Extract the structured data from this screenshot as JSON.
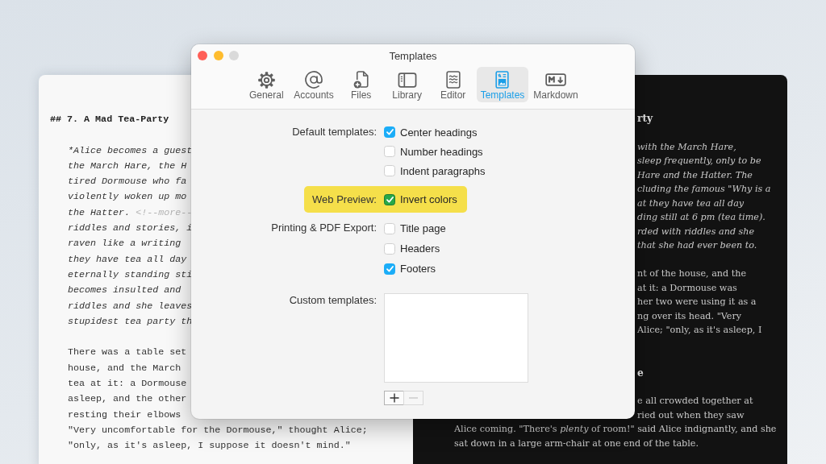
{
  "editor_document": {
    "heading": "## 7. A Mad Tea-Party",
    "paragraphs": [
      {
        "italic": true,
        "lines": [
          {
            "text": "*Alice becomes a guest"
          },
          {
            "text": "the March Hare, the H"
          },
          {
            "text": "tired Dormouse who fa"
          },
          {
            "text": "violently woken up mo"
          },
          {
            "text": "the Hatter.",
            "comment": "<!--more--"
          },
          {
            "text": "riddles and stories, i"
          },
          {
            "text": "raven like a writing"
          },
          {
            "text": "they have tea all day"
          },
          {
            "text": "eternally standing sti"
          },
          {
            "text": "becomes insulted and"
          },
          {
            "text": "riddles and she leaves"
          },
          {
            "text": "stupidest tea party th"
          }
        ]
      },
      {
        "italic": false,
        "lines": [
          {
            "text": "There was a table set"
          },
          {
            "text": "house, and the March"
          },
          {
            "text": "tea at it: a Dormouse"
          },
          {
            "text": "asleep, and the other"
          },
          {
            "text": "resting their elbows"
          },
          {
            "text": "\"Very uncomfortable for the Dormouse,\" thought Alice;"
          },
          {
            "text": "\"only, as it's asleep, I suppose it doesn't mind.\""
          }
        ]
      }
    ]
  },
  "preview_document": {
    "blocks": [
      {
        "kind": "heading",
        "lines": [
          "rty"
        ]
      },
      {
        "kind": "italic",
        "lines": [
          "with the March Hare,",
          "sleep frequently, only to be",
          "Hare and the Hatter. The",
          "cluding the famous \"Why is a",
          "at they have tea all day",
          "ding still at 6 pm (tea time).",
          "rded with riddles and she",
          "that she had ever been to."
        ]
      },
      {
        "kind": "plain",
        "lines": [
          "nt of the house, and the",
          "at it: a Dormouse was",
          "her two were using it as a",
          "ng over its head. \"Very",
          "Alice; \"only, as it's asleep, I"
        ]
      },
      {
        "kind": "heading",
        "lines": [
          "e"
        ]
      },
      {
        "kind": "plain",
        "lines": [
          "e all crowded together at",
          "ried out when they saw",
          "Alice coming. \"There's *plenty* of room!\" said Alice indignantly, and she",
          "sat down in a large arm-chair at one end of the table."
        ]
      }
    ]
  },
  "window": {
    "title": "Templates"
  },
  "toolbar": {
    "tabs": [
      {
        "label": "General",
        "selected": false
      },
      {
        "label": "Accounts",
        "selected": false
      },
      {
        "label": "Files",
        "selected": false
      },
      {
        "label": "Library",
        "selected": false
      },
      {
        "label": "Editor",
        "selected": false
      },
      {
        "label": "Templates",
        "selected": true
      },
      {
        "label": "Markdown",
        "selected": false
      }
    ]
  },
  "settings": {
    "sections": [
      {
        "label": "Default templates:",
        "highlighted": false,
        "options": [
          {
            "label": "Center headings",
            "checked": true
          },
          {
            "label": "Number headings",
            "checked": false
          },
          {
            "label": "Indent paragraphs",
            "checked": false
          }
        ]
      },
      {
        "label": "Web Preview:",
        "highlighted": true,
        "options": [
          {
            "label": "Invert colors",
            "checked": true
          }
        ]
      },
      {
        "label": "Printing & PDF Export:",
        "highlighted": false,
        "options": [
          {
            "label": "Title page",
            "checked": false
          },
          {
            "label": "Headers",
            "checked": false
          },
          {
            "label": "Footers",
            "checked": true
          }
        ]
      }
    ],
    "custom_templates": {
      "label": "Custom templates:",
      "buttons": [
        {
          "kind": "add",
          "disabled": false
        },
        {
          "kind": "remove",
          "disabled": true
        }
      ]
    }
  }
}
